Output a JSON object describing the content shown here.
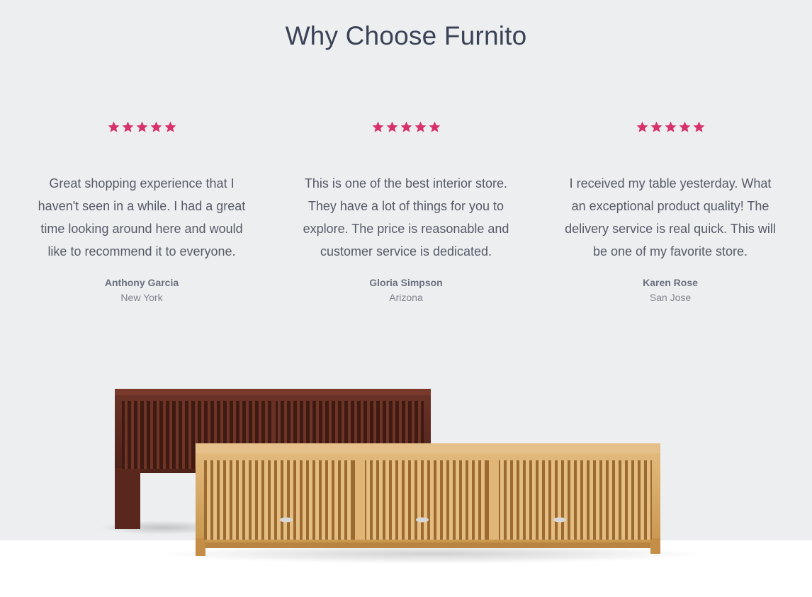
{
  "heading": "Why Choose Furnito",
  "colors": {
    "background": "#edeef0",
    "star": "#d63168",
    "heading": "#3b4256"
  },
  "rating_icon": "star-icon",
  "testimonials": [
    {
      "rating": 5,
      "quote": "Great shopping experience that I haven't seen in a while. I had a great time looking around here and would like to recommend it to everyone.",
      "author": "Anthony Garcia",
      "location": "New York"
    },
    {
      "rating": 5,
      "quote": "This is one of the best interior store. They have a lot of things for you to explore. The price is reasonable and customer service is dedicated.",
      "author": "Gloria Simpson",
      "location": "Arizona"
    },
    {
      "rating": 5,
      "quote": "I received my table yesterday. What an exceptional product quality! The delivery service is real quick. This will be one of my favorite store.",
      "author": "Karen Rose",
      "location": "San Jose"
    }
  ]
}
